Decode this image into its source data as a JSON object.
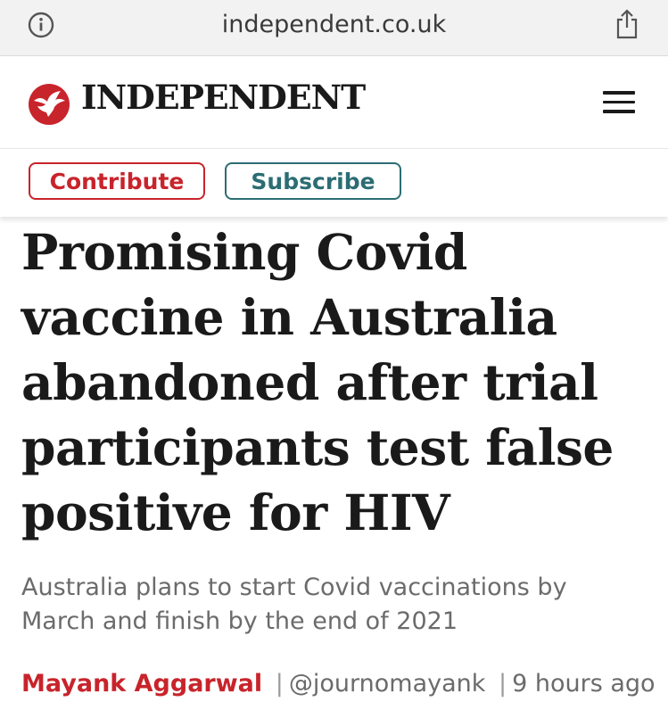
{
  "browser": {
    "url": "independent.co.uk",
    "info_icon": "info-icon",
    "share_icon": "share-icon"
  },
  "site": {
    "logo_icon": "eagle-logo-icon",
    "wordmark": "INDEPENDENT",
    "menu_icon": "hamburger-menu-icon",
    "brand_color": "#c8242b"
  },
  "cta": {
    "contribute_label": "Contribute",
    "subscribe_label": "Subscribe",
    "contribute_color": "#c8242b",
    "subscribe_color": "#2b6d73"
  },
  "article": {
    "headline": "Promising Covid vaccine in Australia abandoned after trial participants test false positive for HIV",
    "standfirst": "Australia plans to start Covid vaccinations by March and finish by the end of 2021",
    "author": "Mayank Aggarwal",
    "handle": "@journomayank",
    "time": "9 hours ago",
    "separator": "|"
  }
}
